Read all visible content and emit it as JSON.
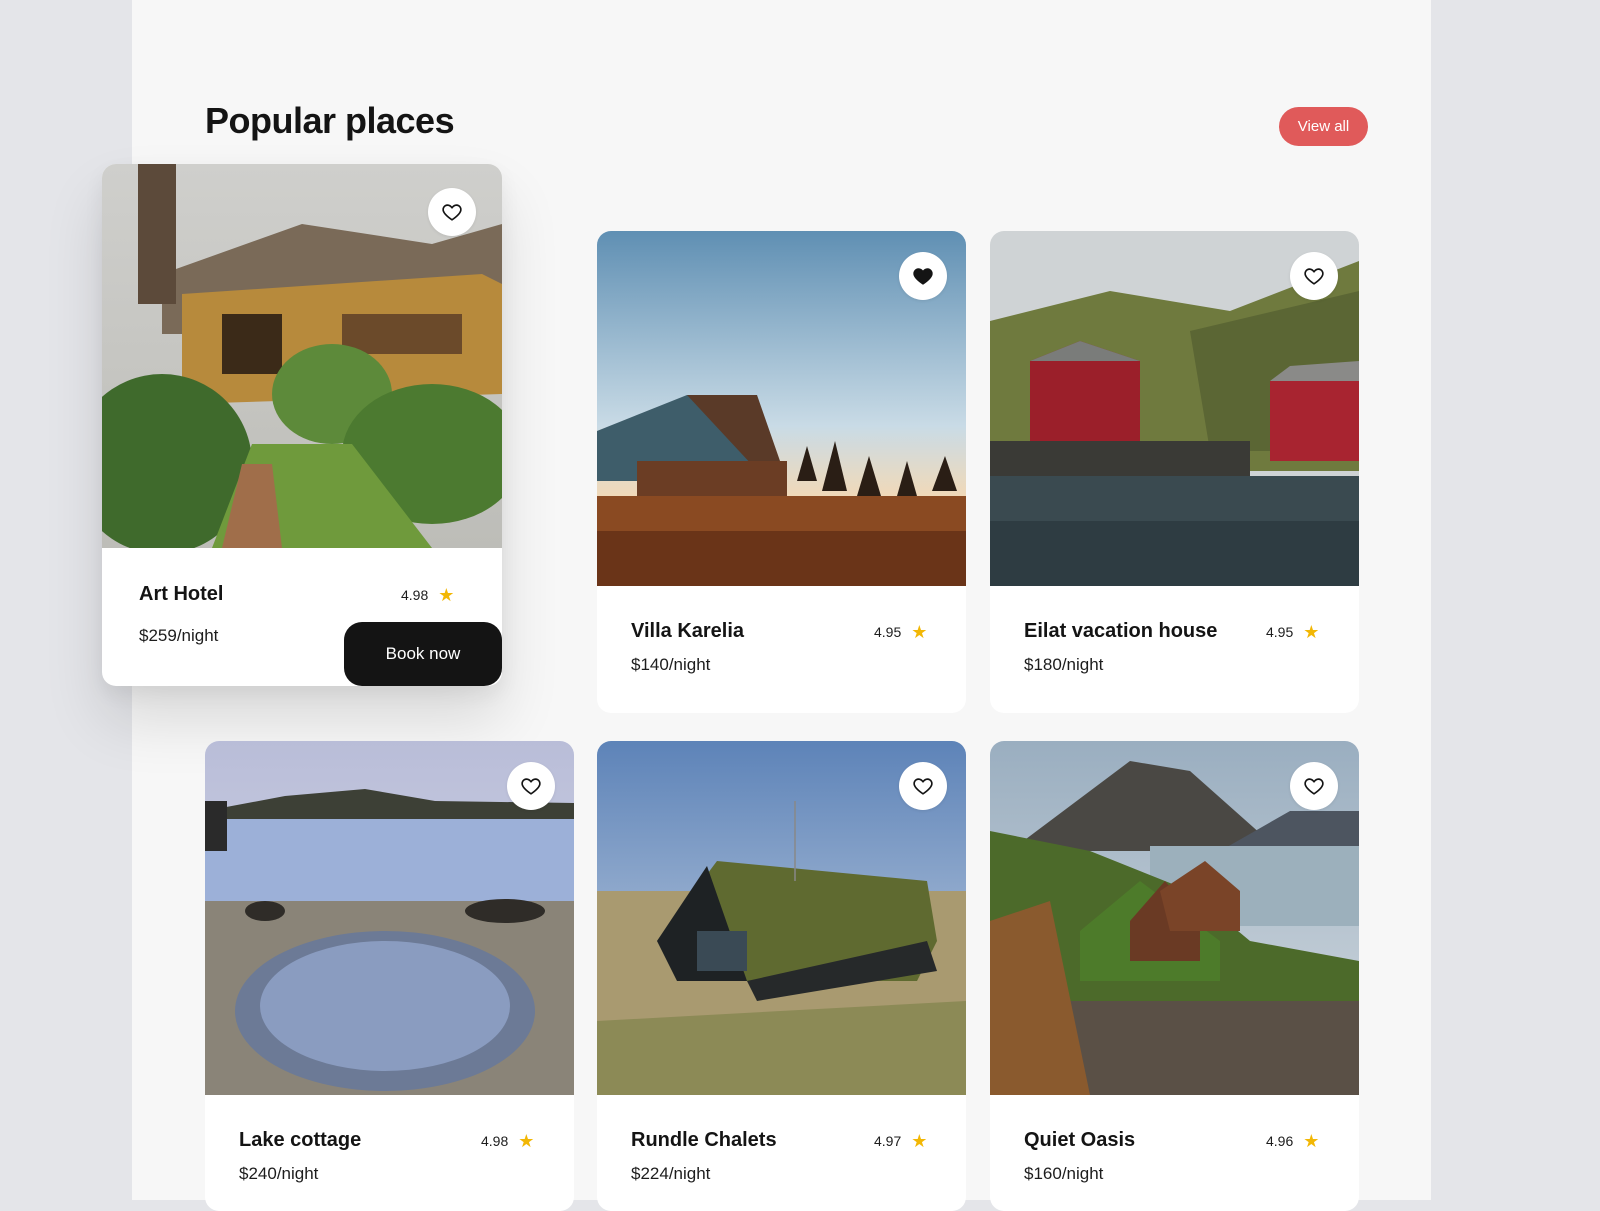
{
  "header": {
    "title": "Popular places",
    "view_all_label": "View all"
  },
  "cards": [
    {
      "name": "Art Hotel",
      "price": "$259/night",
      "rating": "4.98",
      "favorited": false,
      "book_label": "Book now"
    },
    {
      "name": "Villa Karelia",
      "price": "$140/night",
      "rating": "4.95",
      "favorited": true
    },
    {
      "name": "Eilat vacation house",
      "price": "$180/night",
      "rating": "4.95",
      "favorited": false
    },
    {
      "name": "Lake cottage",
      "price": "$240/night",
      "rating": "4.98",
      "favorited": false
    },
    {
      "name": "Rundle Chalets",
      "price": "$224/night",
      "rating": "4.97",
      "favorited": false
    },
    {
      "name": "Quiet Oasis",
      "price": "$160/night",
      "rating": "4.96",
      "favorited": false
    }
  ],
  "icons": {
    "favorite": "heart-icon",
    "rating": "star-icon"
  },
  "colors": {
    "accent": "#e05a5a",
    "star": "#f2b705",
    "dark": "#141414"
  }
}
